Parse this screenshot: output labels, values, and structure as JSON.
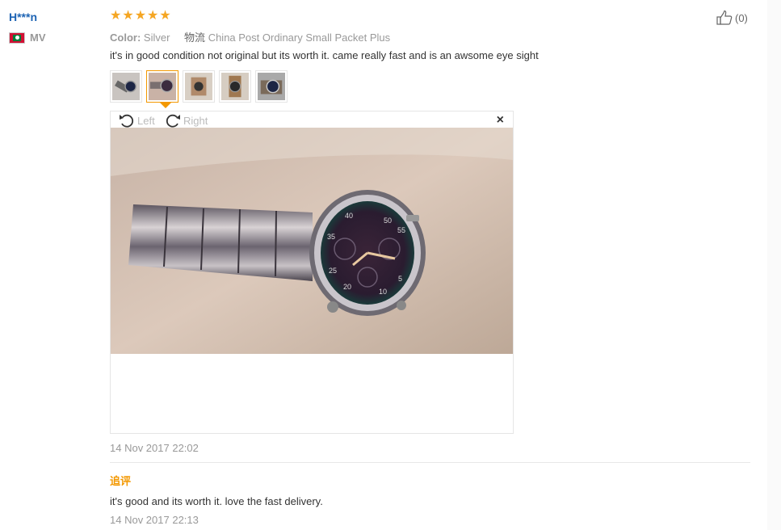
{
  "review": {
    "user_name": "H***n",
    "country_code": "MV",
    "rating": 5,
    "color_label": "Color:",
    "color_value": "Silver",
    "shipping_label": "物流",
    "shipping_value": "China Post Ordinary Small Packet Plus",
    "text": "it's in good condition not original but its worth it. came really fast and is an awsome eye sight",
    "helpful_count": "(0)",
    "thumbnails": [
      "photo-1",
      "photo-2",
      "photo-3",
      "photo-4",
      "photo-5"
    ],
    "active_thumbnail": 2,
    "date": "14 Nov 2017 22:02"
  },
  "viewer": {
    "rotate_left_label": "Left",
    "rotate_right_label": "Right",
    "close_label": "×"
  },
  "followup": {
    "label": "追评",
    "text": "it's good and its worth it. love the fast delivery.",
    "date": "14 Nov 2017 22:13"
  },
  "colors": {
    "user_name": "#1e64b4",
    "star": "#f5a623",
    "accent": "#f39800",
    "muted": "#999999"
  }
}
